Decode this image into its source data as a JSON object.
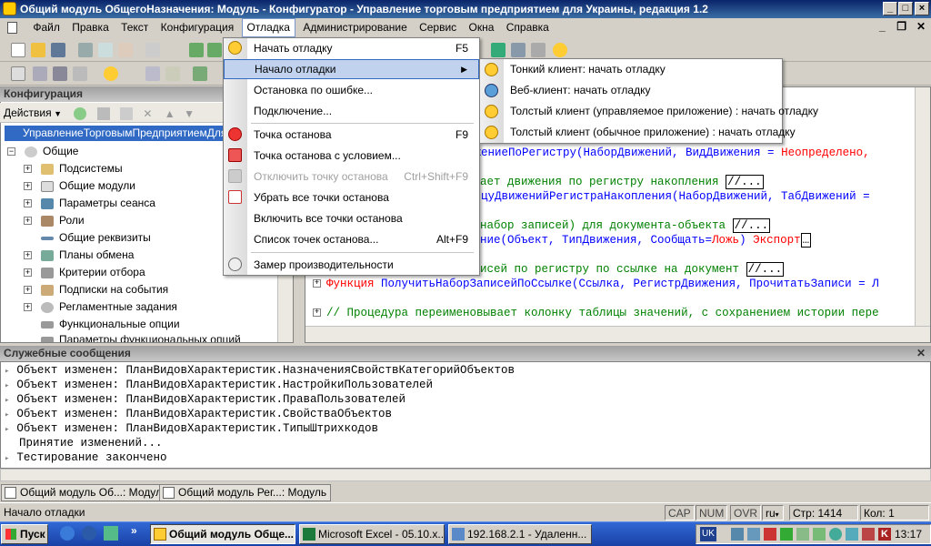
{
  "window": {
    "title": "Общий модуль ОбщегоНазначения: Модуль - Конфигуратор - Управление торговым предприятием для Украины, редакция 1.2"
  },
  "menu": [
    "Файл",
    "Правка",
    "Текст",
    "Конфигурация",
    "Отладка",
    "Администрирование",
    "Сервис",
    "Окна",
    "Справка"
  ],
  "debug_menu": {
    "items": [
      {
        "label": "Начать отладку",
        "shortcut": "F5"
      },
      {
        "label": "Начало отладки",
        "shortcut": ""
      },
      {
        "label": "Остановка по ошибке...",
        "shortcut": ""
      },
      {
        "label": "Подключение...",
        "shortcut": ""
      },
      {
        "label": "Точка останова",
        "shortcut": "F9"
      },
      {
        "label": "Точка останова с условием...",
        "shortcut": ""
      },
      {
        "label": "Отключить точку останова",
        "shortcut": "Ctrl+Shift+F9"
      },
      {
        "label": "Убрать все точки останова",
        "shortcut": ""
      },
      {
        "label": "Включить все точки останова",
        "shortcut": ""
      },
      {
        "label": "Список точек останова...",
        "shortcut": "Alt+F9"
      },
      {
        "label": "Замер производительности",
        "shortcut": ""
      }
    ]
  },
  "submenu": {
    "items": [
      {
        "label": "Тонкий клиент: начать отладку"
      },
      {
        "label": "Веб-клиент: начать отладку"
      },
      {
        "label": "Толстый клиент (управляемое приложение) : начать отладку"
      },
      {
        "label": "Толстый клиент (обычное приложение) : начать отладку"
      }
    ]
  },
  "config": {
    "header": "Конфигурация",
    "actions": "Действия",
    "root": "УправлениеТорговымПредприятиемДляУкраины",
    "general": "Общие",
    "items": [
      "Подсистемы",
      "Общие модули",
      "Параметры сеанса",
      "Роли",
      "Общие реквизиты",
      "Планы обмена",
      "Критерии отбора",
      "Подписки на события",
      "Регламентные задания",
      "Функциональные опции",
      "Параметры функциональных опций"
    ]
  },
  "code": {
    "l1a": "ижениеПоРегистру(НаборДвижений, ВидДвижения = ",
    "l1b": "Неопределено,",
    "l2": "ает движения по регистру накопления",
    "l3": "лицуДвиженийРегистраНакопления(НаборДвижений, ТабДвижений =",
    "l4": "набор записей) для документа-объекта",
    "l5a": "ние(Объект, ТипДвижения, Сообщать=",
    "l5b": "Ложь",
    "l5c": ") ",
    "l5d": "Экспорт",
    "l6": "исей по регистру по ссылке на документ",
    "l7kw": "Функция ",
    "l7": "ПолучитьНаборЗаписейПоСсылке(Ссылка, РегистрДвижения, ПрочитатьЗаписи = Л",
    "l8": "// Процедура переименовывает колонку таблицы значений, с сохранением истории пере",
    "collapsed": "//..."
  },
  "messages": {
    "header": "Служебные сообщения",
    "lines": [
      "Объект изменен: ПланВидовХарактеристик.НазначенияСвойствКатегорийОбъектов",
      "Объект изменен: ПланВидовХарактеристик.НастройкиПользователей",
      "Объект изменен: ПланВидовХарактеристик.ПраваПользователей",
      "Объект изменен: ПланВидовХарактеристик.СвойстваОбъектов",
      "Объект изменен: ПланВидовХарактеристик.ТипыШтрихкодов",
      "Принятие изменений...",
      "Тестирование закончено"
    ]
  },
  "windows_tabs": [
    "Общий модуль Об...: Модуль",
    "Общий модуль Рег...: Модуль"
  ],
  "status": {
    "text": "Начало отладки",
    "cap": "CAP",
    "num": "NUM",
    "ovr": "OVR",
    "lang": "ru",
    "line": "Стр: 1414",
    "col": "Кол: 1"
  },
  "taskbar": {
    "start": "Пуск",
    "tasks": [
      "Общий модуль Обще...",
      "Microsoft Excel - 05.10.x...",
      "192.168.2.1 - Удаленн..."
    ],
    "lang": "UK",
    "time": "13:17"
  }
}
